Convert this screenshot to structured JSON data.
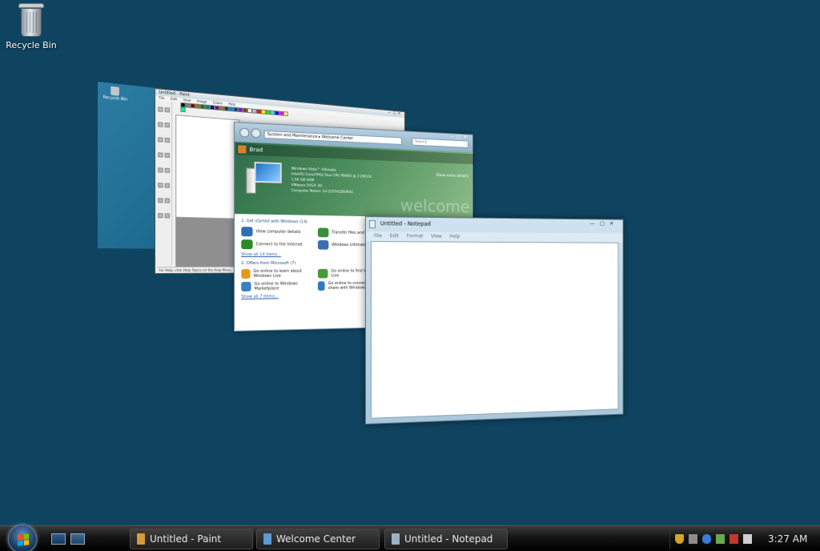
{
  "desktop": {
    "icons": [
      {
        "label": "Recycle Bin",
        "icon": "recycle-bin-icon"
      }
    ],
    "background": "#0f4461"
  },
  "flip3d": {
    "desktop_card": {
      "mini_label": "Recycle Bin"
    },
    "paint": {
      "title": "Untitled - Paint",
      "menu": [
        "File",
        "Edit",
        "View",
        "Image",
        "Colors",
        "Help"
      ],
      "status": "For Help, click Help Topics on the Help Menu.",
      "palette": [
        "#000000",
        "#808080",
        "#800000",
        "#808000",
        "#008000",
        "#008080",
        "#000080",
        "#800080",
        "#808040",
        "#004040",
        "#0080ff",
        "#004080",
        "#8000ff",
        "#804000",
        "#ffffff",
        "#c0c0c0",
        "#ff0000",
        "#ffff00",
        "#00ff00",
        "#00ffff",
        "#0000ff",
        "#ff00ff",
        "#ffff80",
        "#00ff80"
      ]
    },
    "welcome_center": {
      "title": "Welcome Center",
      "address": "System and Maintenance ▸ Welcome Center",
      "search_placeholder": "Search",
      "user": "Brad",
      "specs": [
        "Windows Vista™ Ultimate",
        "Intel(R) Core(TM)2 Duo CPU   P8400 @ 2.26GHz",
        "1.56 GB RAM",
        "VMware SVGA 3D",
        "Computer Name: LH-Z3I7AIZBUR4C"
      ],
      "show_more": "Show more details",
      "watermark": "welcome",
      "section1": "1. Get started with Windows (14)",
      "items1": [
        {
          "label": "View computer details",
          "color": "#2f6fb5"
        },
        {
          "label": "Transfer files and settings",
          "color": "#3c8d3c"
        },
        {
          "label": "Connect to the Internet",
          "color": "#2a8a2a"
        },
        {
          "label": "Windows Ultimate Extras",
          "color": "#3a6fb0"
        }
      ],
      "show_all1": "Show all 14 items...",
      "section2": "2. Offers from Microsoft (7)",
      "items2": [
        {
          "label": "Go online to learn about Windows Live",
          "color": "#e59a1d"
        },
        {
          "label": "Go online to find Windows Live",
          "color": "#4a9a3a"
        },
        {
          "label": "Go online to Windows Marketplace",
          "color": "#3b7fc4"
        },
        {
          "label": "Go online to connect and share with Windows",
          "color": "#2e7bbf"
        }
      ],
      "show_all2": "Show all 7 items..."
    },
    "notepad": {
      "title": "Untitled - Notepad",
      "menu": [
        "File",
        "Edit",
        "Format",
        "View",
        "Help"
      ]
    }
  },
  "taskbar": {
    "start_label": "Start",
    "quick_launch": [
      "show-desktop-icon",
      "switch-windows-icon"
    ],
    "tasks": [
      {
        "label": "Untitled - Paint",
        "icon": "paint-icon",
        "color": "#d89a3a"
      },
      {
        "label": "Welcome Center",
        "icon": "welcome-center-icon",
        "color": "#5b9bd5"
      },
      {
        "label": "Untitled - Notepad",
        "icon": "notepad-icon",
        "color": "#9bb3c4"
      }
    ],
    "tray": {
      "icons": [
        {
          "name": "security-shield-icon",
          "color": "#d8a425"
        },
        {
          "name": "vmware-tools-icon",
          "color": "#8c8c8c"
        },
        {
          "name": "bluetooth-icon",
          "color": "#3d7ad6"
        },
        {
          "name": "network-check-icon",
          "color": "#6aa84f"
        },
        {
          "name": "network-disconnected-icon",
          "color": "#c0392b"
        },
        {
          "name": "volume-icon",
          "color": "#cfcfcf"
        }
      ],
      "clock": "3:27 AM"
    }
  }
}
